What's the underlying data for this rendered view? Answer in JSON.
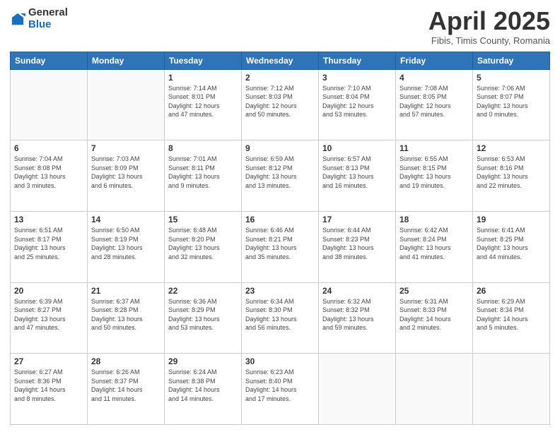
{
  "logo": {
    "general": "General",
    "blue": "Blue"
  },
  "title": "April 2025",
  "location": "Fibis, Timis County, Romania",
  "days_header": [
    "Sunday",
    "Monday",
    "Tuesday",
    "Wednesday",
    "Thursday",
    "Friday",
    "Saturday"
  ],
  "weeks": [
    [
      {
        "day": "",
        "info": ""
      },
      {
        "day": "",
        "info": ""
      },
      {
        "day": "1",
        "info": "Sunrise: 7:14 AM\nSunset: 8:01 PM\nDaylight: 12 hours\nand 47 minutes."
      },
      {
        "day": "2",
        "info": "Sunrise: 7:12 AM\nSunset: 8:03 PM\nDaylight: 12 hours\nand 50 minutes."
      },
      {
        "day": "3",
        "info": "Sunrise: 7:10 AM\nSunset: 8:04 PM\nDaylight: 12 hours\nand 53 minutes."
      },
      {
        "day": "4",
        "info": "Sunrise: 7:08 AM\nSunset: 8:05 PM\nDaylight: 12 hours\nand 57 minutes."
      },
      {
        "day": "5",
        "info": "Sunrise: 7:06 AM\nSunset: 8:07 PM\nDaylight: 13 hours\nand 0 minutes."
      }
    ],
    [
      {
        "day": "6",
        "info": "Sunrise: 7:04 AM\nSunset: 8:08 PM\nDaylight: 13 hours\nand 3 minutes."
      },
      {
        "day": "7",
        "info": "Sunrise: 7:03 AM\nSunset: 8:09 PM\nDaylight: 13 hours\nand 6 minutes."
      },
      {
        "day": "8",
        "info": "Sunrise: 7:01 AM\nSunset: 8:11 PM\nDaylight: 13 hours\nand 9 minutes."
      },
      {
        "day": "9",
        "info": "Sunrise: 6:59 AM\nSunset: 8:12 PM\nDaylight: 13 hours\nand 13 minutes."
      },
      {
        "day": "10",
        "info": "Sunrise: 6:57 AM\nSunset: 8:13 PM\nDaylight: 13 hours\nand 16 minutes."
      },
      {
        "day": "11",
        "info": "Sunrise: 6:55 AM\nSunset: 8:15 PM\nDaylight: 13 hours\nand 19 minutes."
      },
      {
        "day": "12",
        "info": "Sunrise: 6:53 AM\nSunset: 8:16 PM\nDaylight: 13 hours\nand 22 minutes."
      }
    ],
    [
      {
        "day": "13",
        "info": "Sunrise: 6:51 AM\nSunset: 8:17 PM\nDaylight: 13 hours\nand 25 minutes."
      },
      {
        "day": "14",
        "info": "Sunrise: 6:50 AM\nSunset: 8:19 PM\nDaylight: 13 hours\nand 28 minutes."
      },
      {
        "day": "15",
        "info": "Sunrise: 6:48 AM\nSunset: 8:20 PM\nDaylight: 13 hours\nand 32 minutes."
      },
      {
        "day": "16",
        "info": "Sunrise: 6:46 AM\nSunset: 8:21 PM\nDaylight: 13 hours\nand 35 minutes."
      },
      {
        "day": "17",
        "info": "Sunrise: 6:44 AM\nSunset: 8:23 PM\nDaylight: 13 hours\nand 38 minutes."
      },
      {
        "day": "18",
        "info": "Sunrise: 6:42 AM\nSunset: 8:24 PM\nDaylight: 13 hours\nand 41 minutes."
      },
      {
        "day": "19",
        "info": "Sunrise: 6:41 AM\nSunset: 8:25 PM\nDaylight: 13 hours\nand 44 minutes."
      }
    ],
    [
      {
        "day": "20",
        "info": "Sunrise: 6:39 AM\nSunset: 8:27 PM\nDaylight: 13 hours\nand 47 minutes."
      },
      {
        "day": "21",
        "info": "Sunrise: 6:37 AM\nSunset: 8:28 PM\nDaylight: 13 hours\nand 50 minutes."
      },
      {
        "day": "22",
        "info": "Sunrise: 6:36 AM\nSunset: 8:29 PM\nDaylight: 13 hours\nand 53 minutes."
      },
      {
        "day": "23",
        "info": "Sunrise: 6:34 AM\nSunset: 8:30 PM\nDaylight: 13 hours\nand 56 minutes."
      },
      {
        "day": "24",
        "info": "Sunrise: 6:32 AM\nSunset: 8:32 PM\nDaylight: 13 hours\nand 59 minutes."
      },
      {
        "day": "25",
        "info": "Sunrise: 6:31 AM\nSunset: 8:33 PM\nDaylight: 14 hours\nand 2 minutes."
      },
      {
        "day": "26",
        "info": "Sunrise: 6:29 AM\nSunset: 8:34 PM\nDaylight: 14 hours\nand 5 minutes."
      }
    ],
    [
      {
        "day": "27",
        "info": "Sunrise: 6:27 AM\nSunset: 8:36 PM\nDaylight: 14 hours\nand 8 minutes."
      },
      {
        "day": "28",
        "info": "Sunrise: 6:26 AM\nSunset: 8:37 PM\nDaylight: 14 hours\nand 11 minutes."
      },
      {
        "day": "29",
        "info": "Sunrise: 6:24 AM\nSunset: 8:38 PM\nDaylight: 14 hours\nand 14 minutes."
      },
      {
        "day": "30",
        "info": "Sunrise: 6:23 AM\nSunset: 8:40 PM\nDaylight: 14 hours\nand 17 minutes."
      },
      {
        "day": "",
        "info": ""
      },
      {
        "day": "",
        "info": ""
      },
      {
        "day": "",
        "info": ""
      }
    ]
  ]
}
